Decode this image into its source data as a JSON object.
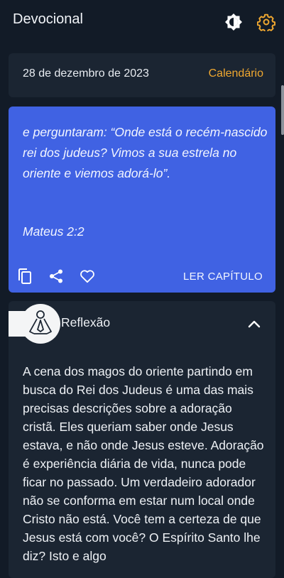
{
  "appbar": {
    "title": "Devocional",
    "icons": [
      "brightness-icon",
      "settings-icon"
    ],
    "accent": "#f0a830"
  },
  "date_card": {
    "date": "28 de dezembro de 2023",
    "calendar_label": "Calendário"
  },
  "verse_card": {
    "text": "e perguntaram: “Onde está o recém-nascido rei dos judeus? Vimos a sua estrela no oriente e viemos adorá-lo”.",
    "reference": "Mateus 2:2",
    "read_chapter_label": "LER CAPÍTULO",
    "background": "#4062e3",
    "actions": [
      "copy-icon",
      "share-icon",
      "heart-icon"
    ]
  },
  "reflection": {
    "title": "Reflexão",
    "body": "A cena dos magos do oriente partindo em busca do Rei dos Judeus é uma das mais precisas descrições sobre a adoração cristã. Eles queriam saber onde Jesus estava, e não onde Jesus esteve. Adoração é experiência diária de vida, nunca pode ficar no passado. Um verdadeiro adorador não se conforma em estar num local onde Cristo não está. Você tem a certeza de que Jesus está com você? O Espírito Santo lhe diz? Isto e algo"
  },
  "colors": {
    "background": "#121b27",
    "card": "#1b2532"
  }
}
